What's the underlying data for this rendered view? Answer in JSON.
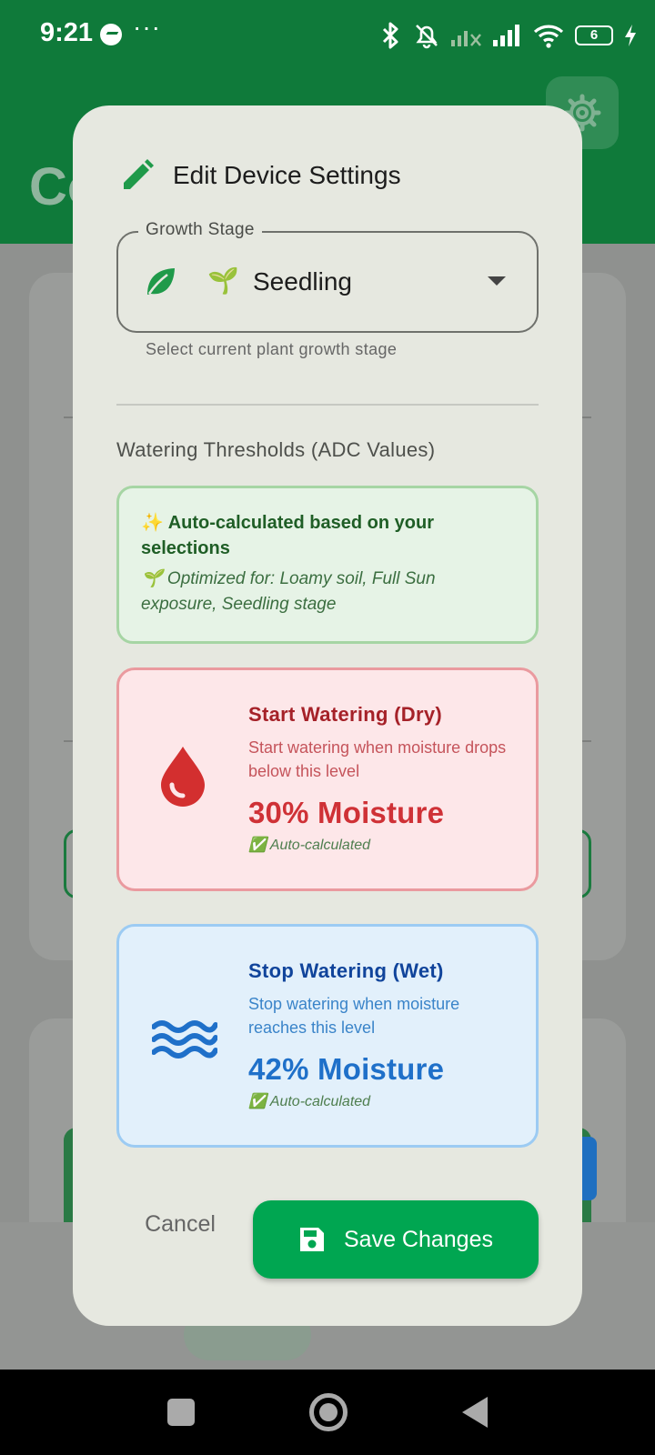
{
  "status_bar": {
    "time": "9:21",
    "more": "···",
    "battery": "6"
  },
  "background": {
    "title_fragment": "Co"
  },
  "dialog": {
    "title": "Edit Device Settings",
    "growth_stage": {
      "label": "Growth Stage",
      "emoji": "🌱",
      "value": "Seedling",
      "helper": "Select current plant growth stage"
    },
    "section_title": "Watering Thresholds (ADC Values)",
    "auto_box": {
      "title": "✨ Auto-calculated based on your selections",
      "description": "🌱 Optimized for: Loamy soil, Full Sun exposure, Seedling stage"
    },
    "start_watering": {
      "title": "Start Watering (Dry)",
      "description": "Start watering when moisture drops below this level",
      "value": "30% Moisture",
      "note": "✅ Auto-calculated"
    },
    "stop_watering": {
      "title": "Stop Watering (Wet)",
      "description": "Stop watering when moisture reaches this level",
      "value": "42% Moisture",
      "note": "✅ Auto-calculated"
    },
    "cancel_label": "Cancel",
    "save_label": "Save Changes"
  },
  "colors": {
    "primary_green": "#0f7a3a",
    "save_button": "#00a651",
    "dry_red": "#cf3136",
    "wet_blue": "#1f70c9"
  },
  "icons": [
    "pencil-icon",
    "leaf-icon",
    "water-drop-icon",
    "waves-icon",
    "save-icon",
    "settings-gear-icon"
  ]
}
